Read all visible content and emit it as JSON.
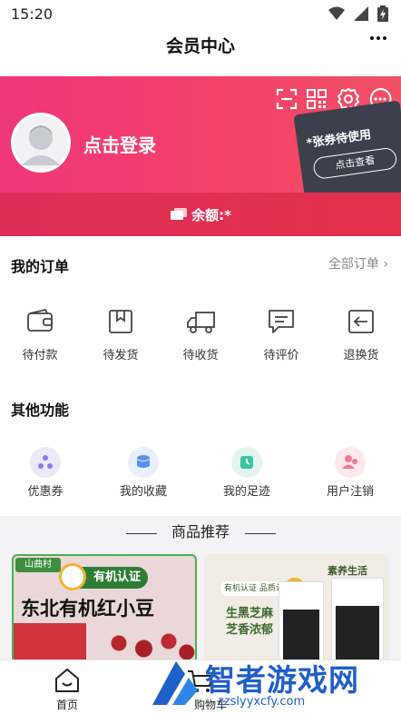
{
  "status_bar": {
    "time": "15:20"
  },
  "header": {
    "title": "会员中心",
    "more_icon": "more-dots-icon"
  },
  "banner": {
    "login_text": "点击登录",
    "balance_text": "余额:*",
    "ticket_title": "*张券待使用",
    "ticket_button": "点击查看",
    "icons": [
      "scan-icon",
      "qrcode-icon",
      "gear-icon",
      "message-icon"
    ],
    "colors": {
      "start": "#f0367a",
      "end": "#f25065"
    }
  },
  "orders": {
    "title": "我的订单",
    "all_label": "全部订单 ›",
    "items": [
      {
        "label": "待付款",
        "icon": "wallet-icon"
      },
      {
        "label": "待发货",
        "icon": "package-icon"
      },
      {
        "label": "待收货",
        "icon": "truck-icon"
      },
      {
        "label": "待评价",
        "icon": "comment-icon"
      },
      {
        "label": "退换货",
        "icon": "return-icon"
      }
    ]
  },
  "others": {
    "title": "其他功能",
    "items": [
      {
        "label": "优惠券",
        "icon": "coupon-icon",
        "color": "#ece9fb"
      },
      {
        "label": "我的收藏",
        "icon": "favorites-icon",
        "color": "#e7f0fc"
      },
      {
        "label": "我的足迹",
        "icon": "footprint-icon",
        "color": "#e2f6f1"
      },
      {
        "label": "用户注销",
        "icon": "user-cancel-icon",
        "color": "#fde9ec"
      }
    ]
  },
  "recommend": {
    "title": "商品推荐",
    "products": [
      {
        "badge": "有机认证",
        "name": "东北有机红小豆",
        "brand": "山曲村"
      },
      {
        "brand": "素养生活",
        "subtitle": "有机认证 品质认证",
        "slogan1": "生黑芝麻",
        "slogan2": "芝香浓郁"
      }
    ]
  },
  "bottom_nav": {
    "items": [
      {
        "label": "首页",
        "icon": "home-icon"
      },
      {
        "label": "购物车",
        "icon": "cart-icon"
      }
    ]
  },
  "watermark": {
    "text": "智者游戏网",
    "url": "zzslyyxcfy.com"
  }
}
